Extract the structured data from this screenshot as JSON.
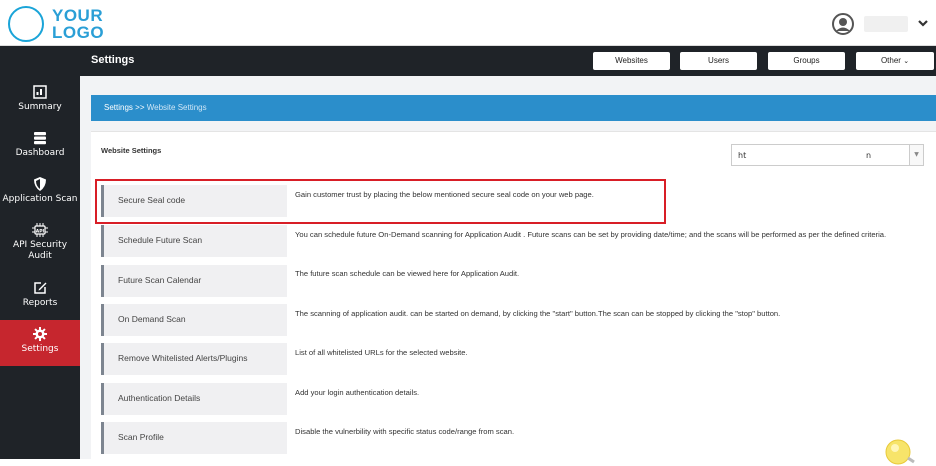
{
  "logo": {
    "line1": "YOUR",
    "line2": "LOGO"
  },
  "header": {
    "title": "Settings",
    "buttons": [
      "Websites",
      "Users",
      "Groups",
      "Other"
    ]
  },
  "sidebar": {
    "items": [
      {
        "label": "Summary",
        "icon": "summary-icon"
      },
      {
        "label": "Dashboard",
        "icon": "dashboard-icon"
      },
      {
        "label": "Application Scan",
        "icon": "shield-icon"
      },
      {
        "label": "API Security Audit",
        "icon": "api-icon"
      },
      {
        "label": "Reports",
        "icon": "edit-icon"
      },
      {
        "label": "Settings",
        "icon": "gear-icon",
        "active": true
      }
    ]
  },
  "breadcrumb": {
    "root": "Settings",
    "sep": ">>",
    "current": "Website Settings"
  },
  "panel": {
    "title": "Website Settings",
    "site_value_start": "ht",
    "site_value_end": "n"
  },
  "rows": [
    {
      "label": "Secure Seal code",
      "desc": "Gain customer trust by placing the below mentioned secure seal code on your web page."
    },
    {
      "label": "Schedule Future Scan",
      "desc": "You can schedule future On-Demand scanning for Application Audit . Future scans can be set by providing date/time; and the scans will be performed as per the defined criteria."
    },
    {
      "label": "Future Scan Calendar",
      "desc": "The future scan schedule can be viewed here for Application Audit."
    },
    {
      "label": "On Demand Scan",
      "desc": "The scanning of application audit. can be started on demand, by clicking the \"start\" button.The scan can be stopped by clicking the \"stop\" button."
    },
    {
      "label": "Remove Whitelisted Alerts/Plugins",
      "desc": "List of all whitelisted URLs for the selected website."
    },
    {
      "label": "Authentication Details",
      "desc": "Add your login authentication details."
    },
    {
      "label": "Scan Profile",
      "desc": "Disable the vulnerbility with specific status code/range from scan."
    }
  ],
  "colors": {
    "accent": "#2b8ecb",
    "active": "#c6262e",
    "sidebar": "#1f2328",
    "highlight": "#d81e26"
  }
}
